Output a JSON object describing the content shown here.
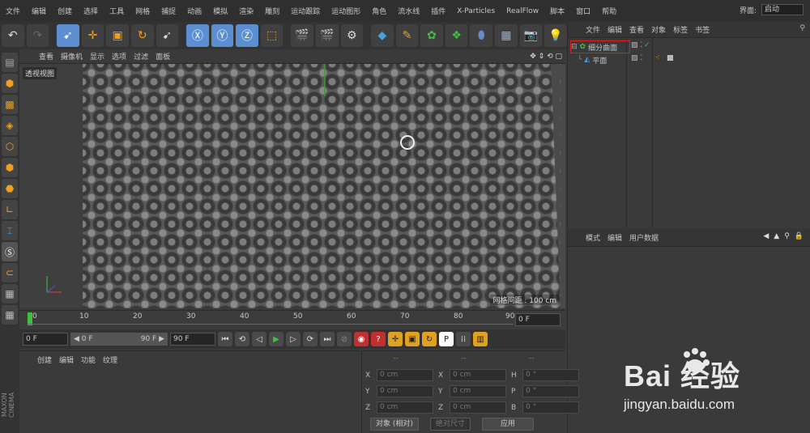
{
  "menubar": {
    "items": [
      "文件",
      "编辑",
      "创建",
      "选择",
      "工具",
      "网格",
      "捕捉",
      "动画",
      "模拟",
      "渲染",
      "雕刻",
      "运动跟踪",
      "运动图形",
      "角色",
      "流水线",
      "插件",
      "X-Particles",
      "RealFlow",
      "脚本",
      "窗口",
      "帮助"
    ],
    "layout_label": "界面:",
    "layout_value": "启动"
  },
  "viewport": {
    "menu": [
      "查看",
      "摄像机",
      "显示",
      "选项",
      "过滤",
      "面板"
    ],
    "label": "透视视图",
    "grid_readout": "网格间距 : 100 cm"
  },
  "timeline": {
    "ticks": [
      "0",
      "10",
      "20",
      "30",
      "40",
      "50",
      "60",
      "70",
      "80",
      "90"
    ],
    "end_field": "0 F"
  },
  "transport": {
    "start_field": "0 F",
    "range_start": "◀ 0 F",
    "range_end": "90 F ▶",
    "end_field": "90 F"
  },
  "object_manager": {
    "menu": [
      "文件",
      "编辑",
      "查看",
      "对象",
      "标签",
      "书签"
    ],
    "objects": [
      {
        "name": "细分曲面",
        "selected": true
      },
      {
        "name": "平面",
        "selected": false
      }
    ]
  },
  "attribute_manager": {
    "menu": [
      "模式",
      "编辑",
      "用户数据"
    ]
  },
  "material_manager": {
    "menu": [
      "创建",
      "编辑",
      "功能",
      "纹理"
    ]
  },
  "coordinates": {
    "headers": [
      "--",
      "--",
      "--"
    ],
    "rows": [
      [
        {
          "l": "X",
          "v": "0 cm"
        },
        {
          "l": "X",
          "v": "0 cm"
        },
        {
          "l": "H",
          "v": "0 °"
        }
      ],
      [
        {
          "l": "Y",
          "v": "0 cm"
        },
        {
          "l": "Y",
          "v": "0 cm"
        },
        {
          "l": "P",
          "v": "0 °"
        }
      ],
      [
        {
          "l": "Z",
          "v": "0 cm"
        },
        {
          "l": "Z",
          "v": "0 cm"
        },
        {
          "l": "B",
          "v": "0 °"
        }
      ]
    ],
    "mode_select": "对象 (相对)",
    "size_select": "绝对尺寸",
    "apply_button": "应用"
  },
  "watermark": {
    "brand": "Bai 经验",
    "site": "jingyan.baidu.com"
  },
  "side_logo": "MAXON CINEMA"
}
